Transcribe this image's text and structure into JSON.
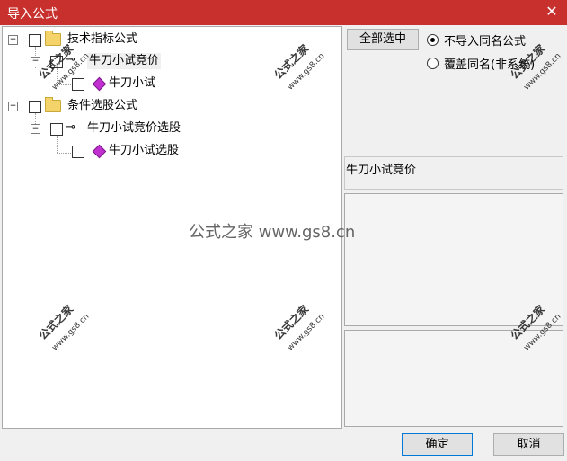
{
  "window": {
    "title": "导入公式"
  },
  "tree": {
    "group1": {
      "label": "技术指标公式"
    },
    "group1_sub": {
      "label": "牛刀小试竞价"
    },
    "group1_item": {
      "label": "牛刀小试"
    },
    "group2": {
      "label": "条件选股公式"
    },
    "group2_sub": {
      "label": "牛刀小试竞价选股"
    },
    "group2_item": {
      "label": "牛刀小试选股"
    }
  },
  "controls": {
    "select_all_label": "全部选中",
    "radio_skip_label": "不导入同名公式",
    "radio_overwrite_label": "覆盖同名(非系统)",
    "radio_selected": "skip"
  },
  "detail": {
    "formula_name": "牛刀小试竞价"
  },
  "buttons": {
    "ok_label": "确定",
    "cancel_label": "取消"
  },
  "watermark": {
    "text": "公式之家",
    "url": "www.gs8.cn",
    "center_text": "公式之家 www.gs8.cn"
  }
}
